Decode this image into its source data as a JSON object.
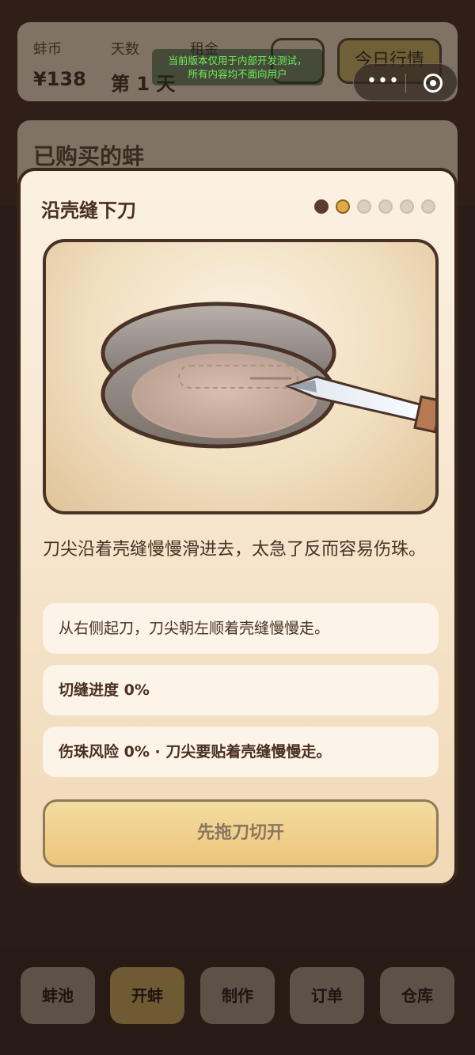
{
  "header": {
    "coins_label": "蚌币",
    "coins_value": "¥138",
    "day_label": "天数",
    "day_value": "第 1 天",
    "rent_label": "租金",
    "market_button": "今日行情"
  },
  "dev_notice": {
    "line1": "当前版本仅用于内部开发测试，",
    "line2": "所有内容均不面向用户"
  },
  "bought_section": {
    "title": "已购买的蚌"
  },
  "modal": {
    "title": "沿壳缝下刀",
    "steps_total": 6,
    "current_step": 2,
    "description": "刀尖沿着壳缝慢慢滑进去，太急了反而容易伤珠。",
    "hint": "从右侧起刀，刀尖朝左顺着壳缝慢慢走。",
    "progress_text": "切缝进度 0%",
    "risk_text": "伤珠风险 0% · 刀尖要贴着壳缝慢慢走。",
    "action_button": "先拖刀切开"
  },
  "cut_progress_percent": 0,
  "injury_risk_percent": 0,
  "nav": {
    "items": [
      "蚌池",
      "开蚌",
      "制作",
      "订单",
      "仓库"
    ],
    "active": "开蚌"
  },
  "colors": {
    "accent": "#e0a946",
    "background": "#2a1c16",
    "modal_bg": "#fbf1e3"
  }
}
